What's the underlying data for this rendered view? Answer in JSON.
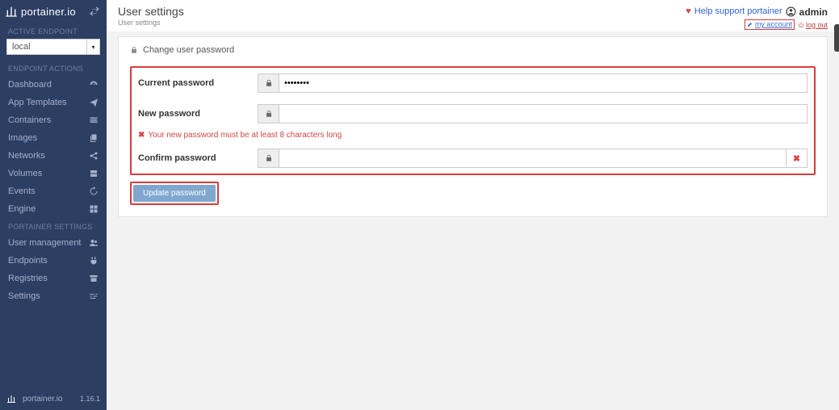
{
  "brand": {
    "name": "portainer.io",
    "footer_name": "portainer.io",
    "version": "1.16.1"
  },
  "sidebar": {
    "active_endpoint_label": "ACTIVE ENDPOINT",
    "endpoint_value": "local",
    "endpoint_actions_label": "ENDPOINT ACTIONS",
    "items": [
      {
        "label": "Dashboard",
        "icon": "dashboard"
      },
      {
        "label": "App Templates",
        "icon": "plane"
      },
      {
        "label": "Containers",
        "icon": "list"
      },
      {
        "label": "Images",
        "icon": "copy"
      },
      {
        "label": "Networks",
        "icon": "share"
      },
      {
        "label": "Volumes",
        "icon": "hdd"
      },
      {
        "label": "Events",
        "icon": "history"
      },
      {
        "label": "Engine",
        "icon": "grid"
      }
    ],
    "portainer_settings_label": "PORTAINER SETTINGS",
    "settings_items": [
      {
        "label": "User management",
        "icon": "users"
      },
      {
        "label": "Endpoints",
        "icon": "plug"
      },
      {
        "label": "Registries",
        "icon": "archive"
      },
      {
        "label": "Settings",
        "icon": "sliders"
      }
    ]
  },
  "header": {
    "title": "User settings",
    "breadcrumb": "User settings",
    "support_text": "Help support portainer",
    "username": "admin",
    "my_account": "my account",
    "logout": "log out"
  },
  "panel": {
    "title": "Change user password",
    "current_label": "Current password",
    "current_value": "••••••••",
    "new_label": "New password",
    "hint": "Your new password must be at least 8 characters long",
    "confirm_label": "Confirm password",
    "button": "Update password"
  }
}
